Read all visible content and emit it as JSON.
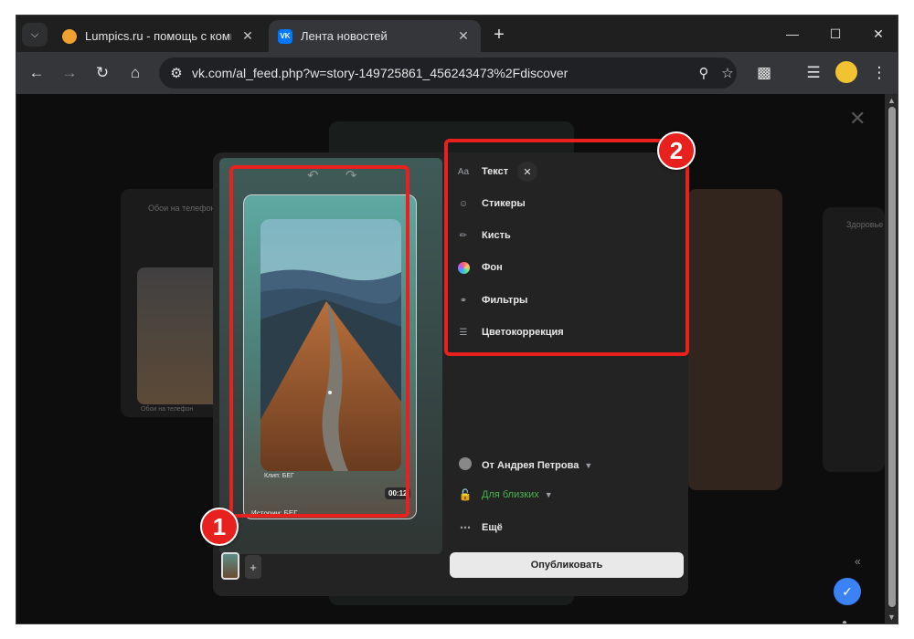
{
  "browser": {
    "tabs": [
      {
        "title": "Lumpics.ru - помощь с компью",
        "favicon_color": "#f0a030"
      },
      {
        "title": "Лента новостей",
        "favicon_color": "#0077ff",
        "active": true
      }
    ],
    "new_tab_label": "+",
    "url": "vk.com/al_feed.php?w=story-149725861_456243473%2Fdiscover"
  },
  "editor": {
    "clip_label": "Клип: БЕГ",
    "timer": "00:12",
    "story_label": "Истории: БЕГ",
    "tools": [
      {
        "label": "Текст",
        "icon": "text-icon"
      },
      {
        "label": "Стикеры",
        "icon": "sticker-icon"
      },
      {
        "label": "Кисть",
        "icon": "brush-icon"
      },
      {
        "label": "Фон",
        "icon": "background-icon"
      },
      {
        "label": "Фильтры",
        "icon": "filters-icon"
      },
      {
        "label": "Цветокоррекция",
        "icon": "color-correction-icon"
      }
    ],
    "author": "От Андрея Петрова",
    "privacy": "Для близких",
    "more": "Ещё",
    "publish": "Опубликовать",
    "privacy_color": "#4bb34b"
  },
  "background_cards": {
    "left_label": "Обои на телефон",
    "left_caption": "Обои на телефон",
    "right_label": "Здоровье"
  },
  "annotations": {
    "badge1": "1",
    "badge2": "2",
    "color": "#e8201e"
  }
}
